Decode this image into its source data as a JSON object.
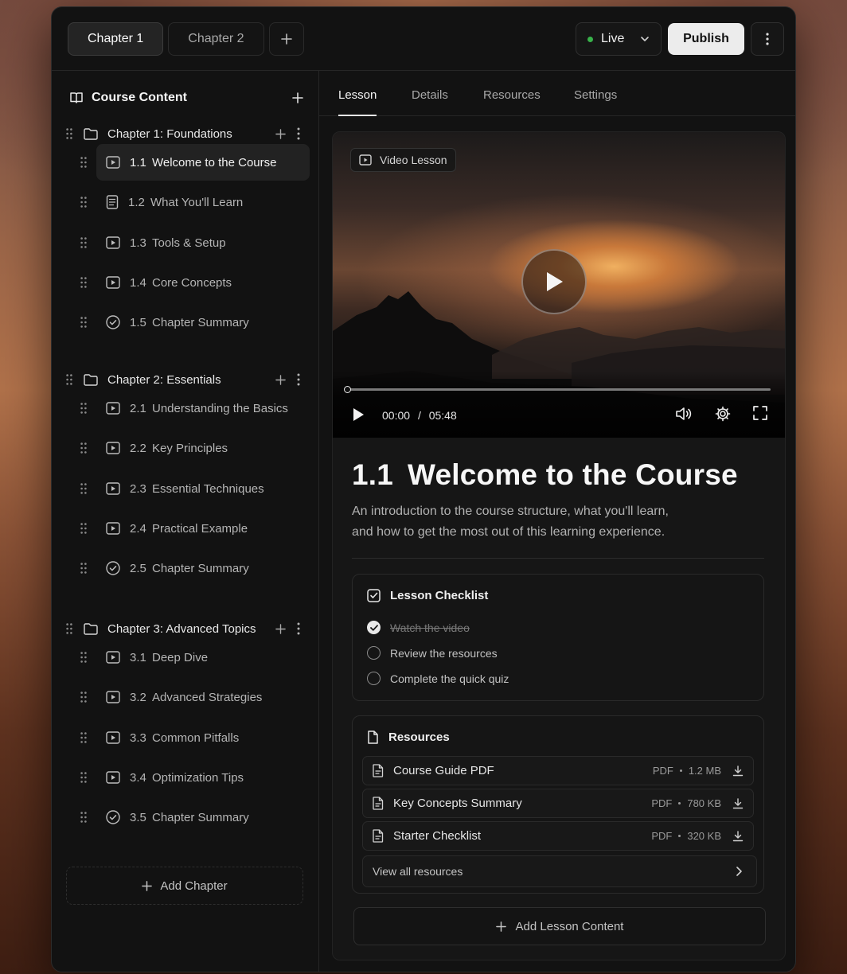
{
  "chapter_tabs": [
    {
      "label": "Chapter 1",
      "active": true
    },
    {
      "label": "Chapter 2",
      "active": false
    }
  ],
  "toolbar": {
    "status_label": "Live",
    "status_color": "#38b24a",
    "publish_label": "Publish"
  },
  "sidebar": {
    "title": "Course Content",
    "chapters": [
      {
        "label": "Chapter 1: Foundations",
        "lessons": [
          {
            "num": "1.1",
            "title": "Welcome to the Course",
            "icon": "video-icon",
            "active": true
          },
          {
            "num": "1.2",
            "title": "What You'll Learn",
            "icon": "document-icon"
          },
          {
            "num": "1.3",
            "title": "Tools & Setup",
            "icon": "video-icon"
          },
          {
            "num": "1.4",
            "title": "Core Concepts",
            "icon": "video-icon"
          },
          {
            "num": "1.5",
            "title": "Chapter Summary",
            "icon": "check-circle-icon"
          }
        ]
      },
      {
        "label": "Chapter 2: Essentials",
        "lessons": [
          {
            "num": "2.1",
            "title": "Understanding the Basics",
            "icon": "video-icon"
          },
          {
            "num": "2.2",
            "title": "Key Principles",
            "icon": "video-icon"
          },
          {
            "num": "2.3",
            "title": "Essential Techniques",
            "icon": "video-icon"
          },
          {
            "num": "2.4",
            "title": "Practical Example",
            "icon": "video-icon"
          },
          {
            "num": "2.5",
            "title": "Chapter Summary",
            "icon": "check-circle-icon"
          }
        ]
      },
      {
        "label": "Chapter 3: Advanced Topics",
        "lessons": [
          {
            "num": "3.1",
            "title": "Deep Dive",
            "icon": "video-icon"
          },
          {
            "num": "3.2",
            "title": "Advanced Strategies",
            "icon": "video-icon"
          },
          {
            "num": "3.3",
            "title": "Common Pitfalls",
            "icon": "video-icon"
          },
          {
            "num": "3.4",
            "title": "Optimization Tips",
            "icon": "video-icon"
          },
          {
            "num": "3.5",
            "title": "Chapter Summary",
            "icon": "check-circle-icon"
          }
        ]
      }
    ],
    "add_chapter_label": "Add Chapter"
  },
  "main_tabs": [
    {
      "label": "Lesson",
      "active": true
    },
    {
      "label": "Details"
    },
    {
      "label": "Resources"
    },
    {
      "label": "Settings"
    }
  ],
  "video": {
    "chip_label": "Video Lesson",
    "current_time": "00:00",
    "separator": "/",
    "duration": "05:48",
    "progress_fraction": 0
  },
  "lesson": {
    "number": "1.1",
    "title": "Welcome to the Course",
    "description_line1": "An introduction to the course structure, what you'll learn,",
    "description_line2": "and how to get the most out of this learning experience."
  },
  "checklist": {
    "title": "Lesson Checklist",
    "items": [
      {
        "label": "Watch the video",
        "done": true
      },
      {
        "label": "Review the resources",
        "done": false
      },
      {
        "label": "Complete the quick quiz",
        "done": false
      }
    ]
  },
  "resources": {
    "title": "Resources",
    "files": [
      {
        "name": "Course Guide PDF",
        "type": "PDF",
        "size": "1.2 MB"
      },
      {
        "name": "Key Concepts Summary",
        "type": "PDF",
        "size": "780 KB"
      },
      {
        "name": "Starter Checklist",
        "type": "PDF",
        "size": "320 KB"
      }
    ],
    "view_all_label": "View all resources"
  },
  "add_content_label": "Add Lesson Content"
}
